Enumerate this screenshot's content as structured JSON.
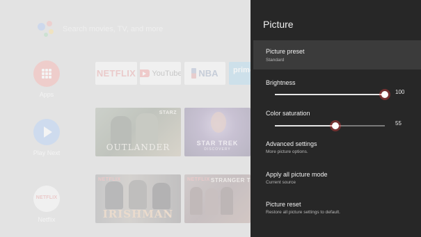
{
  "home": {
    "search_placeholder": "Search movies, TV, and more",
    "nav": [
      {
        "label": "Apps"
      },
      {
        "label": "Play Next"
      },
      {
        "label": "Netflix",
        "logo": "NETFLIX"
      }
    ],
    "apps_row": [
      {
        "name": "NETFLIX"
      },
      {
        "name": "YouTube"
      },
      {
        "name": "NBA"
      },
      {
        "name": "prime"
      }
    ],
    "play_next_row": [
      {
        "title": "OUTLANDER",
        "badge": "STARZ"
      },
      {
        "title": "STAR TREK",
        "subtitle": "DISCOVERY"
      }
    ],
    "netflix_row": [
      {
        "title": "IRISHMAN",
        "badge": "NETFLIX"
      },
      {
        "title": "STRANGER T",
        "badge": "NETFLIX"
      }
    ]
  },
  "panel": {
    "title": "Picture",
    "preset": {
      "label": "Picture preset",
      "value": "Standard"
    },
    "brightness": {
      "label": "Brightness",
      "value": "100",
      "level": 1.0
    },
    "saturation": {
      "label": "Color saturation",
      "value": "55",
      "level": 0.55
    },
    "advanced": {
      "label": "Advanced settings",
      "sub": "More picture options."
    },
    "apply_all": {
      "label": "Apply all picture mode",
      "sub": "Current source"
    },
    "reset": {
      "label": "Picture reset",
      "sub": "Restore all picture settings to default."
    }
  },
  "colors": {
    "panel_bg": "#272727",
    "selected_row": "#3b3b3b",
    "home_bg": "#d9d9d9"
  }
}
